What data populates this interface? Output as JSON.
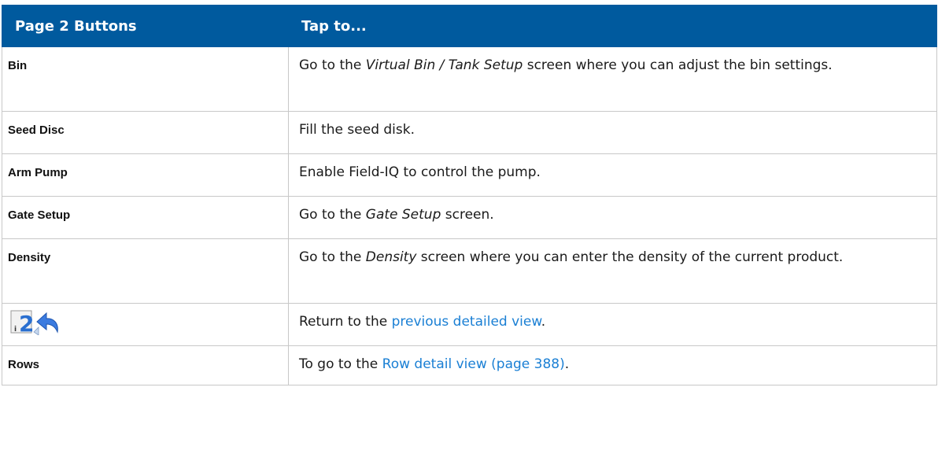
{
  "header": {
    "col1": "Page 2 Buttons",
    "col2": "Tap to..."
  },
  "rows": [
    {
      "button": "Bin",
      "pre": "Go to the ",
      "em": "Virtual Bin / Tank Setup",
      "post": " screen where you can adjust the bin settings."
    },
    {
      "button": "Seed Disc",
      "text": "Fill the seed disk."
    },
    {
      "button": "Arm Pump",
      "text": "Enable Field-IQ to control the pump."
    },
    {
      "button": "Gate Setup",
      "pre": "Go to the ",
      "em": "Gate Setup",
      "post": " screen."
    },
    {
      "button": "Density",
      "pre": "Go to the ",
      "em": "Density",
      "post": " screen where you can enter the density of the current product."
    },
    {
      "button_icon": "page-2-back-icon",
      "icon_digit": "2",
      "pre": "Return to the ",
      "link": "previous detailed view",
      "post": "."
    },
    {
      "button": "Rows",
      "pre": "To go to the ",
      "link": "Row detail view (page 388)",
      "post": "."
    }
  ],
  "colors": {
    "header_bg": "#005a9e",
    "link": "#1a7fd4",
    "border": "#c8c8c8"
  }
}
